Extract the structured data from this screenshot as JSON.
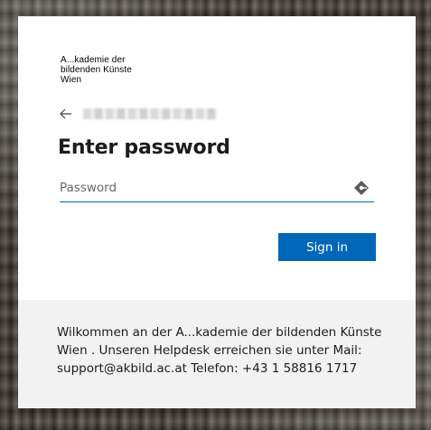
{
  "logo": {
    "lines": [
      "A...kademie der",
      "bildenden Künste",
      "Wien"
    ]
  },
  "identity": {
    "back_icon": "arrow-left-icon"
  },
  "form": {
    "title": "Enter password",
    "password_placeholder": "Password",
    "password_value": "",
    "reveal_icon": "password-reveal-key-icon",
    "submit_label": "Sign in"
  },
  "footer": {
    "text": "Wilkommen an der A...kademie der bildenden Künste Wien . Unseren Helpdesk erreichen sie unter Mail: support@akbild.ac.at Telefon: +43 1 58816 1717"
  },
  "colors": {
    "accent": "#0067b8",
    "footer_bg": "#f2f2f2",
    "text": "#1b1b1b"
  }
}
